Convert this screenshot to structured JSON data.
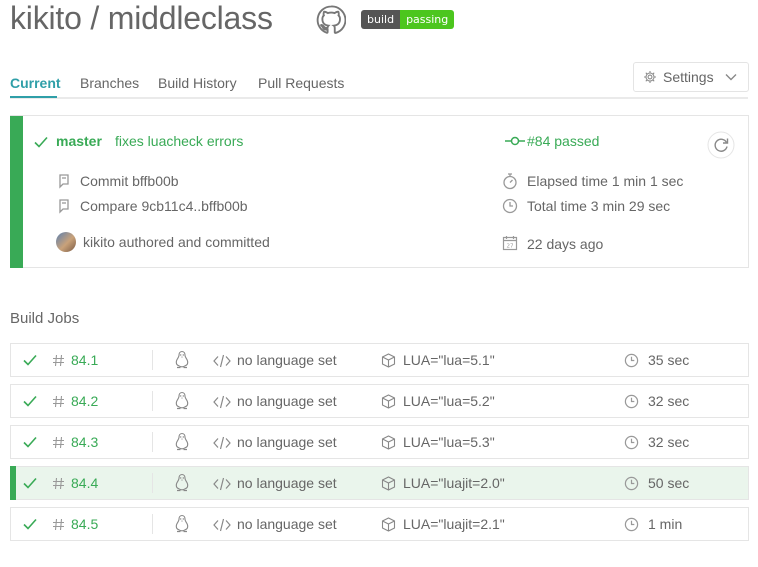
{
  "repo": {
    "owner": "kikito",
    "separator": " / ",
    "name": "middleclass",
    "full_title": "kikito / middleclass"
  },
  "badge": {
    "left": "build",
    "right": "passing"
  },
  "tabs": [
    {
      "label": "Current",
      "active": true
    },
    {
      "label": "Branches"
    },
    {
      "label": "Build History"
    },
    {
      "label": "Pull Requests"
    }
  ],
  "settings": {
    "label": "Settings"
  },
  "build": {
    "branch": "master",
    "message": "fixes luacheck errors",
    "status": "#84 passed",
    "commit": "Commit bffb00b",
    "compare": "Compare 9cb11c4..bffb00b",
    "author": "kikito authored and committed",
    "elapsed": "Elapsed time 1 min 1 sec",
    "total": "Total time 3 min 29 sec",
    "date": "22 days ago"
  },
  "jobs_title": "Build Jobs",
  "jobs": [
    {
      "number": "84.1",
      "language": "no language set",
      "env": "LUA=\"lua=5.1\"",
      "duration": "35 sec"
    },
    {
      "number": "84.2",
      "language": "no language set",
      "env": "LUA=\"lua=5.2\"",
      "duration": "32 sec"
    },
    {
      "number": "84.3",
      "language": "no language set",
      "env": "LUA=\"lua=5.3\"",
      "duration": "32 sec"
    },
    {
      "number": "84.4",
      "language": "no language set",
      "env": "LUA=\"luajit=2.0\"",
      "duration": "50 sec",
      "highlighted": true
    },
    {
      "number": "84.5",
      "language": "no language set",
      "env": "LUA=\"luajit=2.1\"",
      "duration": "1 min"
    }
  ],
  "colors": {
    "passed": "#39aa56",
    "tab_active": "#2f9fa8",
    "badge_passing": "#4cc61e",
    "badge_build": "#555555",
    "text": "#666666",
    "border": "#e5e5e5"
  },
  "icons": {
    "check": "check-icon",
    "hash": "hash-icon",
    "linux": "linux-tux-icon",
    "code": "code-icon",
    "box": "box-icon",
    "clock": "clock-icon",
    "stopwatch": "stopwatch-icon",
    "calendar": "calendar-icon",
    "commit": "commit-icon",
    "restart": "restart-icon",
    "github": "github-icon",
    "gear": "gear-icon"
  }
}
